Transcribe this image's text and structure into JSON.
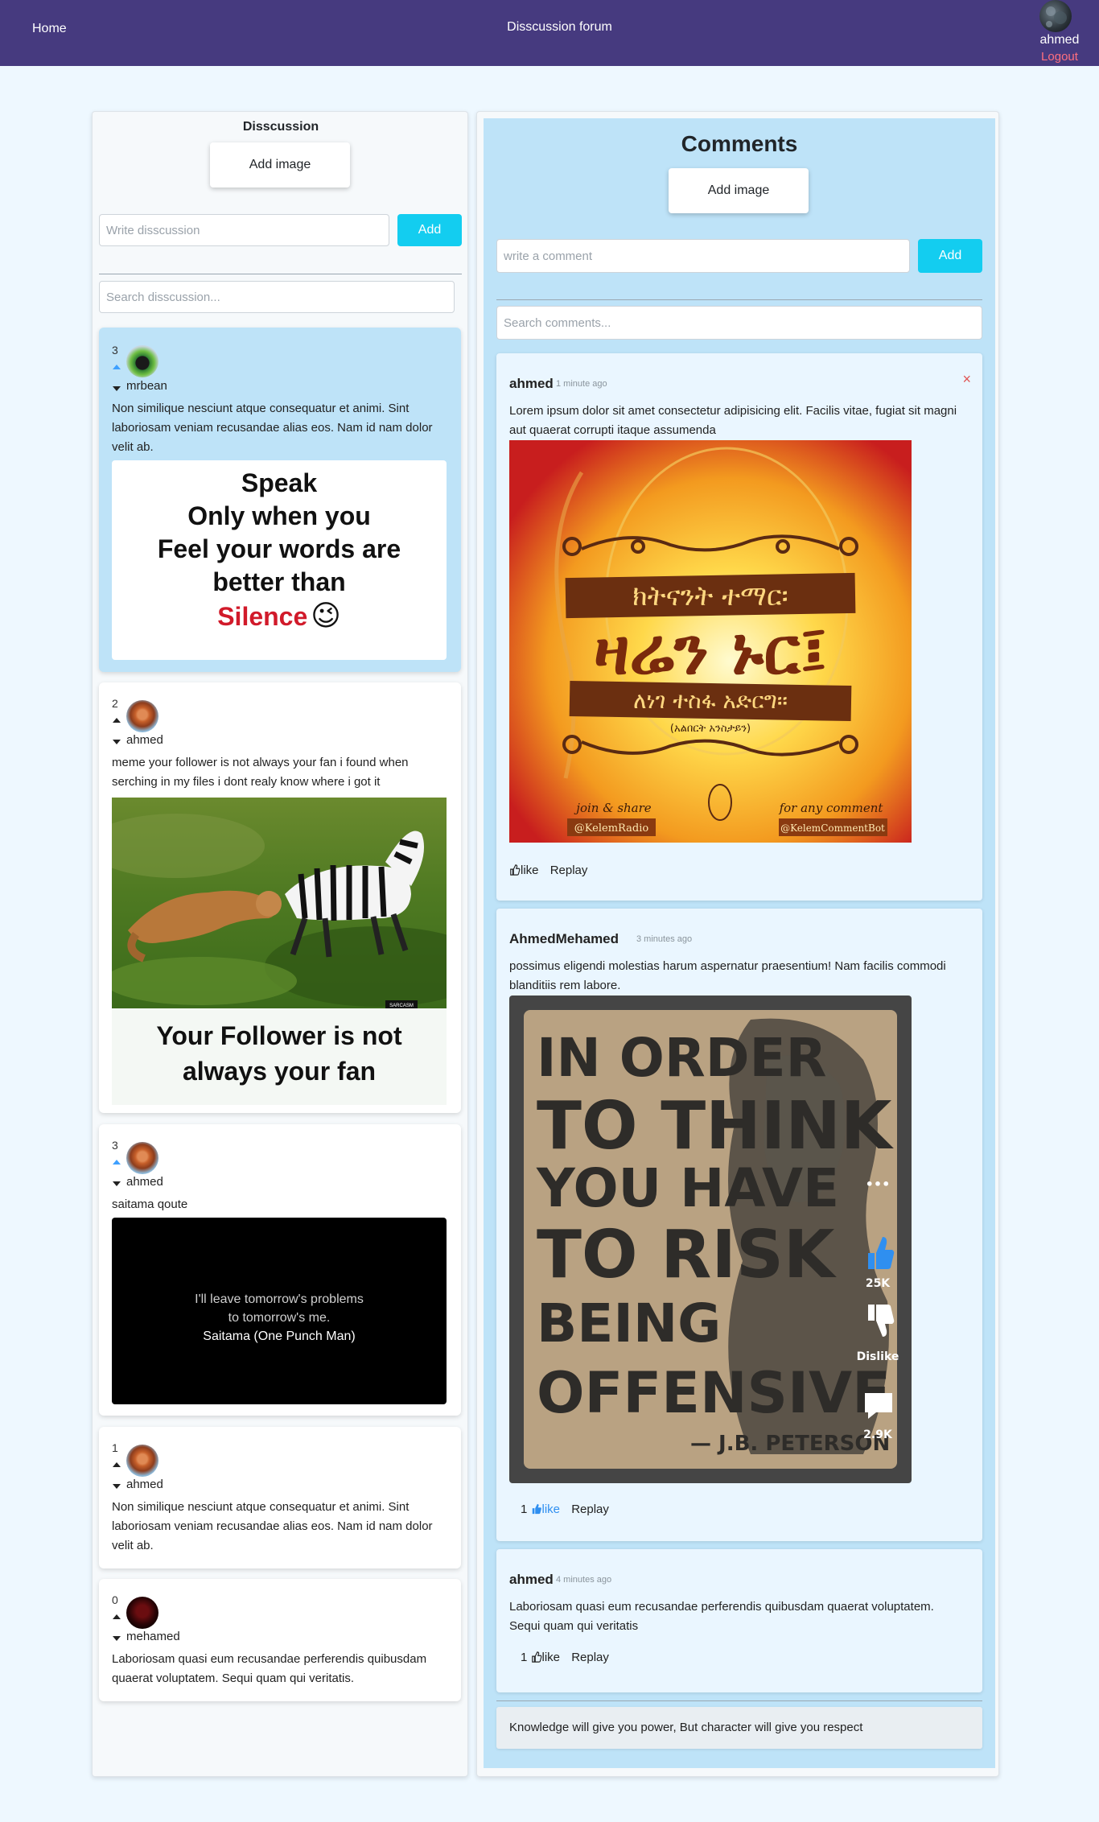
{
  "nav": {
    "home": "Home",
    "title": "Disscussion forum",
    "user": "ahmed",
    "logout": "Logout"
  },
  "left": {
    "title": "Disscussion",
    "add_image": "Add image",
    "discussion_placeholder": "Write disscussion",
    "add": "Add",
    "search_placeholder": "Search disscussion..."
  },
  "posts": [
    {
      "votes": "3",
      "user": "mrbean",
      "text": "Non similique nesciunt atque consequatur et animi. Sint laboriosam veniam recusandae alias eos. Nam id nam dolor velit ab.",
      "image": {
        "line1": "Speak",
        "line2": "Only when you",
        "line3": "Feel your words are",
        "line4": "better than",
        "line5": "Silence",
        "emoji": "😉"
      }
    },
    {
      "votes": "2",
      "user": "ahmed",
      "text": "meme your follower is not always your fan i found when serching in my files i dont realy know where i got it",
      "image": {
        "caption1": "Your Follower is not",
        "caption2": "always your fan",
        "watermark": "SARCASM"
      }
    },
    {
      "votes": "3",
      "user": "ahmed",
      "text": "saitama qoute",
      "image": {
        "line1": "I'll leave tomorrow's problems",
        "line2": "to tomorrow's me.",
        "author": "Saitama (One Punch Man)"
      }
    },
    {
      "votes": "1",
      "user": "ahmed",
      "text": "Non similique nesciunt atque consequatur et animi. Sint laboriosam veniam recusandae alias eos. Nam id nam dolor velit ab."
    },
    {
      "votes": "0",
      "user": "mehamed",
      "text": "Laboriosam quasi eum recusandae perferendis quibusdam quaerat voluptatem. Sequi quam qui veritatis."
    }
  ],
  "right": {
    "title": "Comments",
    "add_image": "Add image",
    "comment_placeholder": "write a comment",
    "add": "Add",
    "search_placeholder": "Search comments...",
    "close": "×"
  },
  "comments": [
    {
      "user": "ahmed",
      "time": "1 minute ago",
      "text": "Lorem ipsum dolor sit amet consectetur adipisicing elit. Facilis vitae, fugiat sit magni aut quaerat corrupti itaque assumenda",
      "likes": "",
      "like": "like",
      "reply": "Replay",
      "image": {
        "line1": "ክትናንት ተማር፡",
        "line2": "ዛሬን ኑር፤",
        "line3": "ለነገ ተስፋ አድርግ።",
        "line4": "(አልበርት አንስታይን)",
        "join": "join & share",
        "handle1": "@KelemRadio",
        "comment_label": "for any comment",
        "handle2": "@KelemCommentBot"
      }
    },
    {
      "user": "AhmedMehamed",
      "time": "3 minutes ago",
      "text": "possimus eligendi molestias harum aspernatur praesentium! Nam facilis commodi blanditiis rem labore.",
      "likes": "1",
      "like": "like",
      "reply": "Replay",
      "image": {
        "l1": "IN ORDER",
        "l2": "TO THINK",
        "l3": "YOU HAVE",
        "l4": "TO RISK",
        "l5": "BEING",
        "l6": "OFFENSIVE",
        "author": "— J.B. PETERSON",
        "likes": "25K",
        "dislike": "Dislike",
        "comments": "2.9K",
        "more": "•••"
      }
    },
    {
      "user": "ahmed",
      "time": "4 minutes ago",
      "text": "Laboriosam quasi eum recusandae perferendis quibusdam quaerat voluptatem. Sequi quam qui veritatis",
      "likes": "1",
      "like": "like",
      "reply": "Replay"
    }
  ],
  "quote": "Knowledge will give you power, But character will give you respect",
  "colors": {
    "navbar": "#463a7f",
    "accent": "#13cdf0",
    "active_post": "#bee3f8",
    "logout": "#ff6f7f"
  }
}
